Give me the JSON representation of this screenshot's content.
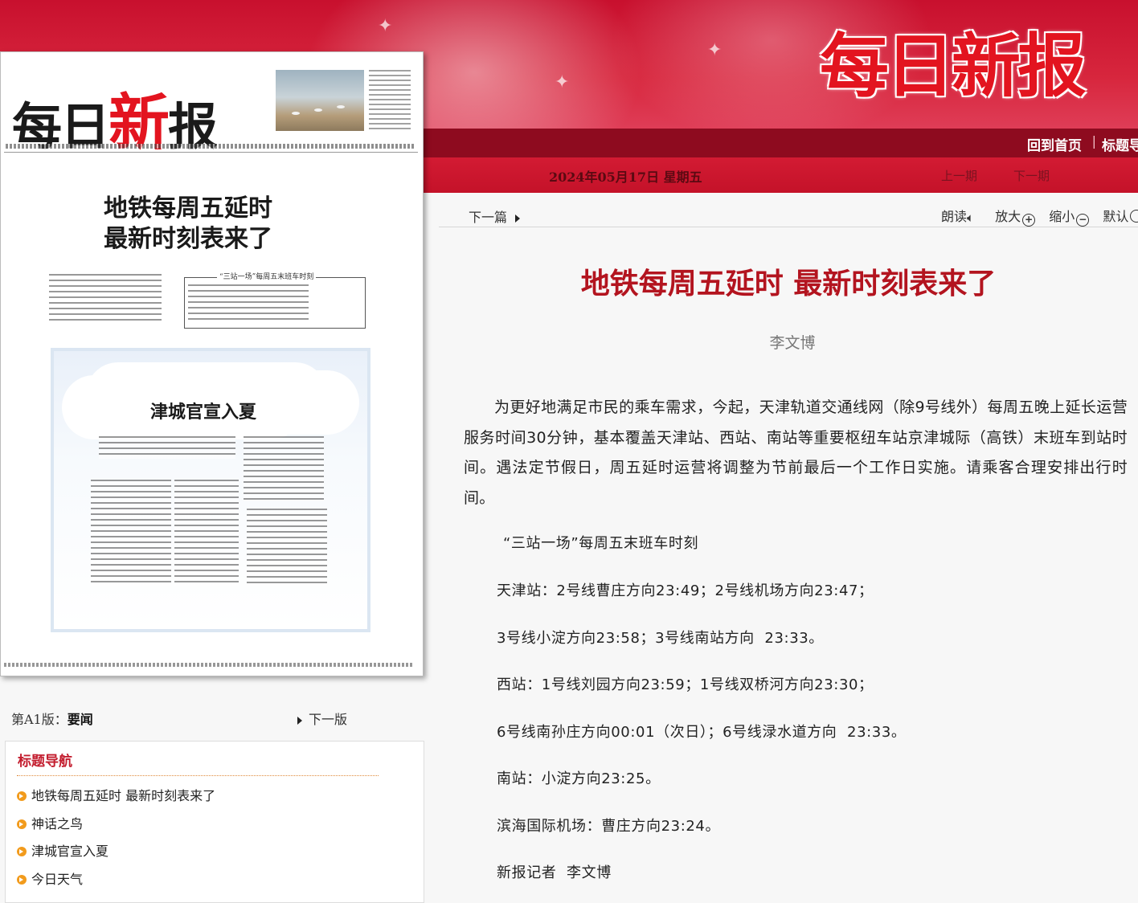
{
  "header": {
    "logo_text": "每日新报",
    "nav": {
      "home": "回到首页",
      "separator": "|",
      "index": "标题导"
    },
    "date": "2024年05月17日  星期五",
    "prev_issue": "上一期",
    "next_issue": "下一期"
  },
  "paper": {
    "masthead_a": "每日",
    "masthead_b": "新",
    "masthead_c": "报",
    "headline_1": "地铁每周五延时",
    "headline_2": "最新时刻表来了",
    "timetable_title": "“三站一场”每周五末班车时刻",
    "box_title": "津城官宣入夏"
  },
  "edition": {
    "label": "第A1版：",
    "name": "要闻",
    "next": "下一版"
  },
  "toc": {
    "title": "标题导航",
    "items": [
      "地铁每周五延时  最新时刻表来了",
      "神话之鸟",
      "津城官宣入夏",
      "今日天气"
    ]
  },
  "toolbar": {
    "next_article": "下一篇",
    "read": "朗读",
    "zoom_in": "放大",
    "zoom_out": "缩小",
    "default": "默认"
  },
  "article": {
    "title": "地铁每周五延时  最新时刻表来了",
    "author": "李文博",
    "intro": "为更好地满足市民的乘车需求，今起，天津轨道交通线网（除9号线外）每周五晚上延长运营服务时间30分钟，基本覆盖天津站、西站、南站等重要枢纽车站京津城际（高铁）末班车到站时间。遇法定节假日，周五延时运营将调整为节前最后一个工作日实施。请乘客合理安排出行时间。",
    "lines": [
      "“三站一场”每周五末班车时刻",
      "天津站：2号线曹庄方向23:49；2号线机场方向23:47；",
      "3号线小淀方向23:58；3号线南站方向  23:33。",
      "西站：1号线刘园方向23:59；1号线双桥河方向23:30；",
      "6号线南孙庄方向00:01（次日）；6号线渌水道方向  23:33。",
      "南站：小淀方向23:25。",
      "滨海国际机场：曹庄方向23:24。",
      "新报记者  李文博"
    ]
  }
}
